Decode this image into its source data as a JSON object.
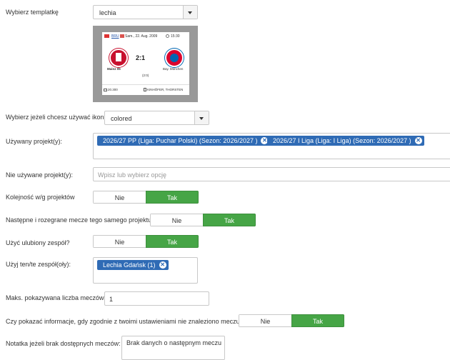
{
  "template": {
    "label": "Wybierz templatkę",
    "value": "lechia"
  },
  "preview": {
    "league": "BRU",
    "date": "Sam., 22. Aug. 2009",
    "time": "15:30",
    "home_team": "Mainz 05",
    "away_team": "Bay. München",
    "score": "2:1",
    "halftime": "(2:0)",
    "attendance": "20.300",
    "referee": "KINHÖFER, THORSTEN"
  },
  "icons": {
    "label": "Wybierz jeżeli chcesz używać ikon",
    "value": "colored"
  },
  "used_projects": {
    "label": "Używany projekt(y):",
    "items": [
      "2026/27 PP (Liga: Puchar Polski) (Sezon: 2026/2027 )",
      "2026/27 I Liga (Liga: I Liga) (Sezon: 2026/2027 )"
    ]
  },
  "unused_projects": {
    "label": "Nie używane projekt(y):",
    "placeholder": "Wpisz lub wybierz opcję"
  },
  "order": {
    "label": "Kolejność w/g projektów",
    "no": "Nie",
    "yes": "Tak"
  },
  "next_played": {
    "label": "Następne i rozegrane mecze tego samego projektu",
    "no": "Nie",
    "yes": "Tak"
  },
  "favorite": {
    "label": "Użyć ulubiony zespół?",
    "no": "Nie",
    "yes": "Tak"
  },
  "teams": {
    "label": "Użyj ten/te zespół(oły):",
    "items": [
      "Lechia Gdańsk (1)"
    ]
  },
  "max_matches": {
    "label": "Maks. pokazywana liczba meczów",
    "value": "1"
  },
  "no_match_info": {
    "label": "Czy pokazać informacje, gdy zgodnie z twoimi ustawieniami nie znaleziono meczu?",
    "no": "Nie",
    "yes": "Tak"
  },
  "note": {
    "label": "Notatka jeżeli brak dostępnych meczów:",
    "value": "Brak danych o następnym meczu"
  },
  "colors": {
    "chip": "#2f6bb5",
    "active": "#46a546"
  }
}
